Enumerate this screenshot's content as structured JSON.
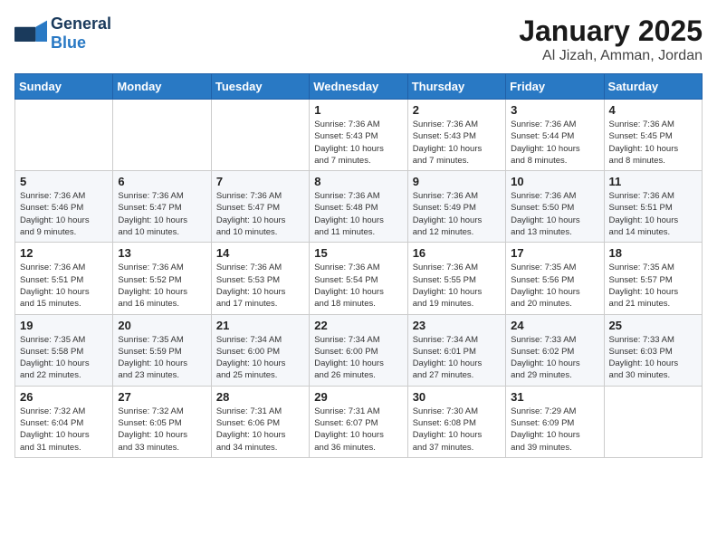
{
  "header": {
    "logo_general": "General",
    "logo_blue": "Blue",
    "title": "January 2025",
    "subtitle": "Al Jizah, Amman, Jordan"
  },
  "weekdays": [
    "Sunday",
    "Monday",
    "Tuesday",
    "Wednesday",
    "Thursday",
    "Friday",
    "Saturday"
  ],
  "weeks": [
    [
      {
        "day": "",
        "info": ""
      },
      {
        "day": "",
        "info": ""
      },
      {
        "day": "",
        "info": ""
      },
      {
        "day": "1",
        "info": "Sunrise: 7:36 AM\nSunset: 5:43 PM\nDaylight: 10 hours\nand 7 minutes."
      },
      {
        "day": "2",
        "info": "Sunrise: 7:36 AM\nSunset: 5:43 PM\nDaylight: 10 hours\nand 7 minutes."
      },
      {
        "day": "3",
        "info": "Sunrise: 7:36 AM\nSunset: 5:44 PM\nDaylight: 10 hours\nand 8 minutes."
      },
      {
        "day": "4",
        "info": "Sunrise: 7:36 AM\nSunset: 5:45 PM\nDaylight: 10 hours\nand 8 minutes."
      }
    ],
    [
      {
        "day": "5",
        "info": "Sunrise: 7:36 AM\nSunset: 5:46 PM\nDaylight: 10 hours\nand 9 minutes."
      },
      {
        "day": "6",
        "info": "Sunrise: 7:36 AM\nSunset: 5:47 PM\nDaylight: 10 hours\nand 10 minutes."
      },
      {
        "day": "7",
        "info": "Sunrise: 7:36 AM\nSunset: 5:47 PM\nDaylight: 10 hours\nand 10 minutes."
      },
      {
        "day": "8",
        "info": "Sunrise: 7:36 AM\nSunset: 5:48 PM\nDaylight: 10 hours\nand 11 minutes."
      },
      {
        "day": "9",
        "info": "Sunrise: 7:36 AM\nSunset: 5:49 PM\nDaylight: 10 hours\nand 12 minutes."
      },
      {
        "day": "10",
        "info": "Sunrise: 7:36 AM\nSunset: 5:50 PM\nDaylight: 10 hours\nand 13 minutes."
      },
      {
        "day": "11",
        "info": "Sunrise: 7:36 AM\nSunset: 5:51 PM\nDaylight: 10 hours\nand 14 minutes."
      }
    ],
    [
      {
        "day": "12",
        "info": "Sunrise: 7:36 AM\nSunset: 5:51 PM\nDaylight: 10 hours\nand 15 minutes."
      },
      {
        "day": "13",
        "info": "Sunrise: 7:36 AM\nSunset: 5:52 PM\nDaylight: 10 hours\nand 16 minutes."
      },
      {
        "day": "14",
        "info": "Sunrise: 7:36 AM\nSunset: 5:53 PM\nDaylight: 10 hours\nand 17 minutes."
      },
      {
        "day": "15",
        "info": "Sunrise: 7:36 AM\nSunset: 5:54 PM\nDaylight: 10 hours\nand 18 minutes."
      },
      {
        "day": "16",
        "info": "Sunrise: 7:36 AM\nSunset: 5:55 PM\nDaylight: 10 hours\nand 19 minutes."
      },
      {
        "day": "17",
        "info": "Sunrise: 7:35 AM\nSunset: 5:56 PM\nDaylight: 10 hours\nand 20 minutes."
      },
      {
        "day": "18",
        "info": "Sunrise: 7:35 AM\nSunset: 5:57 PM\nDaylight: 10 hours\nand 21 minutes."
      }
    ],
    [
      {
        "day": "19",
        "info": "Sunrise: 7:35 AM\nSunset: 5:58 PM\nDaylight: 10 hours\nand 22 minutes."
      },
      {
        "day": "20",
        "info": "Sunrise: 7:35 AM\nSunset: 5:59 PM\nDaylight: 10 hours\nand 23 minutes."
      },
      {
        "day": "21",
        "info": "Sunrise: 7:34 AM\nSunset: 6:00 PM\nDaylight: 10 hours\nand 25 minutes."
      },
      {
        "day": "22",
        "info": "Sunrise: 7:34 AM\nSunset: 6:00 PM\nDaylight: 10 hours\nand 26 minutes."
      },
      {
        "day": "23",
        "info": "Sunrise: 7:34 AM\nSunset: 6:01 PM\nDaylight: 10 hours\nand 27 minutes."
      },
      {
        "day": "24",
        "info": "Sunrise: 7:33 AM\nSunset: 6:02 PM\nDaylight: 10 hours\nand 29 minutes."
      },
      {
        "day": "25",
        "info": "Sunrise: 7:33 AM\nSunset: 6:03 PM\nDaylight: 10 hours\nand 30 minutes."
      }
    ],
    [
      {
        "day": "26",
        "info": "Sunrise: 7:32 AM\nSunset: 6:04 PM\nDaylight: 10 hours\nand 31 minutes."
      },
      {
        "day": "27",
        "info": "Sunrise: 7:32 AM\nSunset: 6:05 PM\nDaylight: 10 hours\nand 33 minutes."
      },
      {
        "day": "28",
        "info": "Sunrise: 7:31 AM\nSunset: 6:06 PM\nDaylight: 10 hours\nand 34 minutes."
      },
      {
        "day": "29",
        "info": "Sunrise: 7:31 AM\nSunset: 6:07 PM\nDaylight: 10 hours\nand 36 minutes."
      },
      {
        "day": "30",
        "info": "Sunrise: 7:30 AM\nSunset: 6:08 PM\nDaylight: 10 hours\nand 37 minutes."
      },
      {
        "day": "31",
        "info": "Sunrise: 7:29 AM\nSunset: 6:09 PM\nDaylight: 10 hours\nand 39 minutes."
      },
      {
        "day": "",
        "info": ""
      }
    ]
  ]
}
